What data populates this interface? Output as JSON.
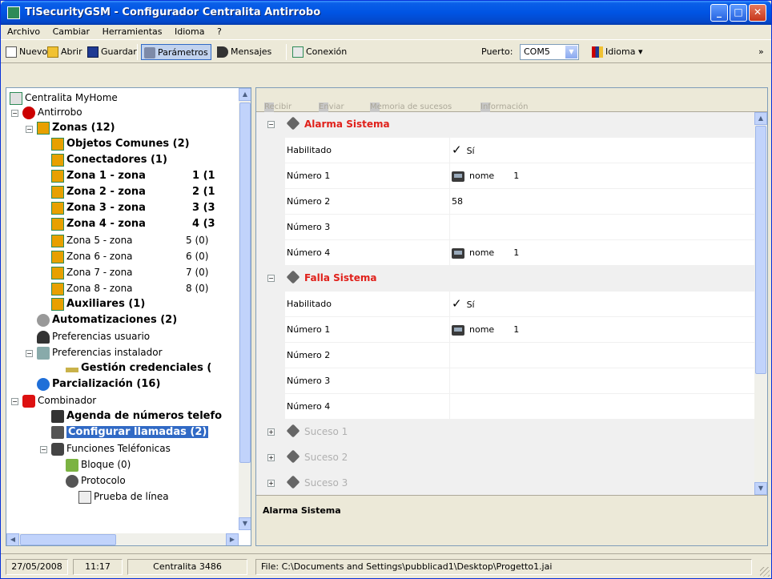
{
  "window": {
    "title": "TiSecurityGSM - Configurador Centralita Antirrobo",
    "controls": {
      "minimize": "_",
      "maximize": "□",
      "close": "✕"
    }
  },
  "menubar": [
    "Archivo",
    "Cambiar",
    "Herramientas",
    "Idioma",
    "?"
  ],
  "toolbar": {
    "nuevo": "Nuevo",
    "abrir": "Abrir",
    "guardar": "Guardar",
    "parametros": "Parámetros",
    "mensajes": "Mensajes",
    "conexion": "Conexión",
    "puerto_label": "Puerto:",
    "puerto_value": "COM5",
    "idioma": "Idioma",
    "overflow": "»"
  },
  "tree": {
    "items": [
      {
        "label": "Centralita MyHome",
        "count": ""
      },
      {
        "label": "Antirrobo",
        "count": ""
      },
      {
        "label": "Zonas (12)",
        "count": ""
      },
      {
        "label": "Objetos Comunes (2)",
        "count": ""
      },
      {
        "label": "Conectadores (1)",
        "count": ""
      },
      {
        "label": "Zona 1 - zona",
        "count": "1 (1"
      },
      {
        "label": "Zona 2 - zona",
        "count": "2 (1"
      },
      {
        "label": "Zona 3 - zona",
        "count": "3 (3"
      },
      {
        "label": "Zona 4 - zona",
        "count": "4 (3"
      },
      {
        "label": "Zona 5 - zona",
        "count": "5 (0)"
      },
      {
        "label": "Zona 6 - zona",
        "count": "6 (0)"
      },
      {
        "label": "Zona 7 - zona",
        "count": "7 (0)"
      },
      {
        "label": "Zona 8 - zona",
        "count": "8 (0)"
      },
      {
        "label": "Auxiliares (1)",
        "count": ""
      },
      {
        "label": "Automatizaciones (2)",
        "count": ""
      },
      {
        "label": "Preferencias usuario",
        "count": ""
      },
      {
        "label": "Preferencias instalador",
        "count": ""
      },
      {
        "label": "Gestión credenciales (",
        "count": ""
      },
      {
        "label": "Parcialización (16)",
        "count": ""
      },
      {
        "label": "Combinador",
        "count": ""
      },
      {
        "label": "Agenda de números telefo",
        "count": ""
      },
      {
        "label": "Configurar llamadas (2)",
        "count": ""
      },
      {
        "label": "Funciones Teléfonicas",
        "count": ""
      },
      {
        "label": "Bloque (0)",
        "count": ""
      },
      {
        "label": "Protocolo",
        "count": ""
      },
      {
        "label": "Prueba de línea",
        "count": ""
      }
    ]
  },
  "right_toolbar": {
    "recibir": "Recibir",
    "enviar": "Enviar",
    "memoria": "Memoria de sucesos",
    "informacion": "Información"
  },
  "grid": {
    "section1_title": "Alarma Sistema",
    "section2_title": "Falla Sistema",
    "habilitado": "Habilitado",
    "si": "Sí",
    "check": "✓",
    "numero1": "Número 1",
    "numero2": "Número 2",
    "numero3": "Número 3",
    "numero4": "Número 4",
    "nome": "nome",
    "one": "1",
    "num2_value": "58",
    "suceso1": "Suceso 1",
    "suceso2": "Suceso 2",
    "suceso3": "Suceso 3",
    "plus": "+",
    "minus": "−"
  },
  "description": {
    "title": "Alarma Sistema"
  },
  "statusbar": {
    "date": "27/05/2008",
    "time": "11:17",
    "device": "Centralita 3486",
    "file": "File: C:\\Documents and Settings\\pubblicad1\\Desktop\\Progetto1.jai"
  }
}
